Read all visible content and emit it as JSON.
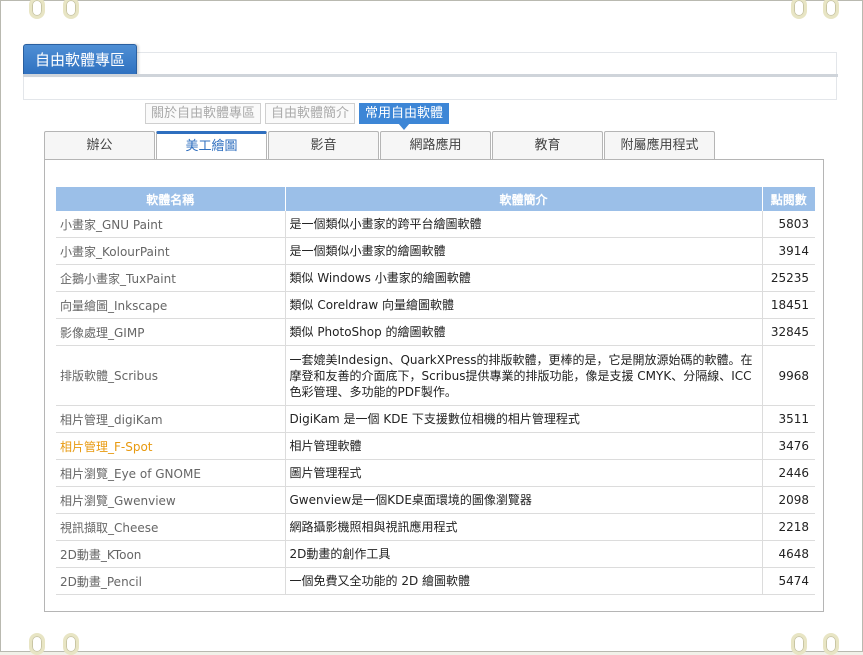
{
  "page": {
    "title": "自由軟體專區"
  },
  "subtabs": [
    {
      "label": "關於自由軟體專區",
      "active": false
    },
    {
      "label": "自由軟體簡介",
      "active": false
    },
    {
      "label": "常用自由軟體",
      "active": true
    }
  ],
  "tabs": [
    {
      "label": "辦公",
      "active": false
    },
    {
      "label": "美工繪圖",
      "active": true
    },
    {
      "label": "影音",
      "active": false
    },
    {
      "label": "網路應用",
      "active": false
    },
    {
      "label": "教育",
      "active": false
    },
    {
      "label": "附屬應用程式",
      "active": false
    }
  ],
  "table": {
    "headers": [
      "軟體名稱",
      "軟體簡介",
      "點閱數"
    ],
    "rows": [
      {
        "name": "小畫家_GNU Paint",
        "desc": "是一個類似小畫家的跨平台繪圖軟體",
        "views": "5803"
      },
      {
        "name": "小畫家_KolourPaint",
        "desc": "是一個類似小畫家的繪圖軟體",
        "views": "3914"
      },
      {
        "name": "企鵝小畫家_TuxPaint",
        "desc": "類似 Windows 小畫家的繪圖軟體",
        "views": "25235"
      },
      {
        "name": "向量繪圖_Inkscape",
        "desc": "類似 Coreldraw 向量繪圖軟體",
        "views": "18451"
      },
      {
        "name": "影像處理_GIMP",
        "desc": "類似 PhotoShop 的繪圖軟體",
        "views": "32845"
      },
      {
        "name": "排版軟體_Scribus",
        "desc": "一套媲美Indesign、QuarkXPress的排版軟體，更棒的是，它是開放源始碼的軟體。在摩登和友善的介面底下，Scribus提供專業的排版功能，像是支援 CMYK、分隔線、ICC色彩管理、多功能的PDF製作。",
        "views": "9968"
      },
      {
        "name": "相片管理_digiKam",
        "desc": "DigiKam 是一個 KDE 下支援數位相機的相片管理程式",
        "views": "3511"
      },
      {
        "name": "相片管理_F-Spot",
        "desc": "相片管理軟體",
        "views": "3476"
      },
      {
        "name": "相片瀏覽_Eye of GNOME",
        "desc": "圖片管理程式",
        "views": "2446"
      },
      {
        "name": "相片瀏覽_Gwenview",
        "desc": "Gwenview是一個KDE桌面環境的圖像瀏覽器",
        "views": "2098"
      },
      {
        "name": "視訊擷取_Cheese",
        "desc": "網路攝影機照相與視訊應用程式",
        "views": "2218"
      },
      {
        "name": "2D動畫_KToon",
        "desc": "2D動畫的創作工具",
        "views": "4648"
      },
      {
        "name": "2D動畫_Pencil",
        "desc": "一個免費又全功能的 2D 繪圖軟體",
        "views": "5474"
      }
    ]
  }
}
